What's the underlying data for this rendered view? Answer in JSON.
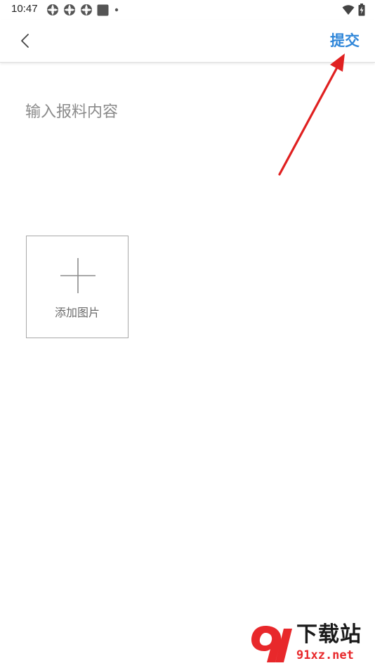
{
  "status_bar": {
    "time": "10:47",
    "left_icons": [
      "gear-icon",
      "gear-icon",
      "gear-icon",
      "square-icon",
      "dot-icon"
    ],
    "right_icons": [
      "wifi-icon",
      "battery-icon"
    ]
  },
  "nav": {
    "back_icon": "chevron-left-icon",
    "submit_label": "提交",
    "accent_color": "#2f86d9"
  },
  "form": {
    "content_placeholder": "输入报料内容",
    "content_value": "",
    "add_image_label": "添加图片"
  },
  "annotation": {
    "arrow_color": "#e02020"
  },
  "watermark": {
    "title": "下载站",
    "domain": "91xz.net"
  }
}
